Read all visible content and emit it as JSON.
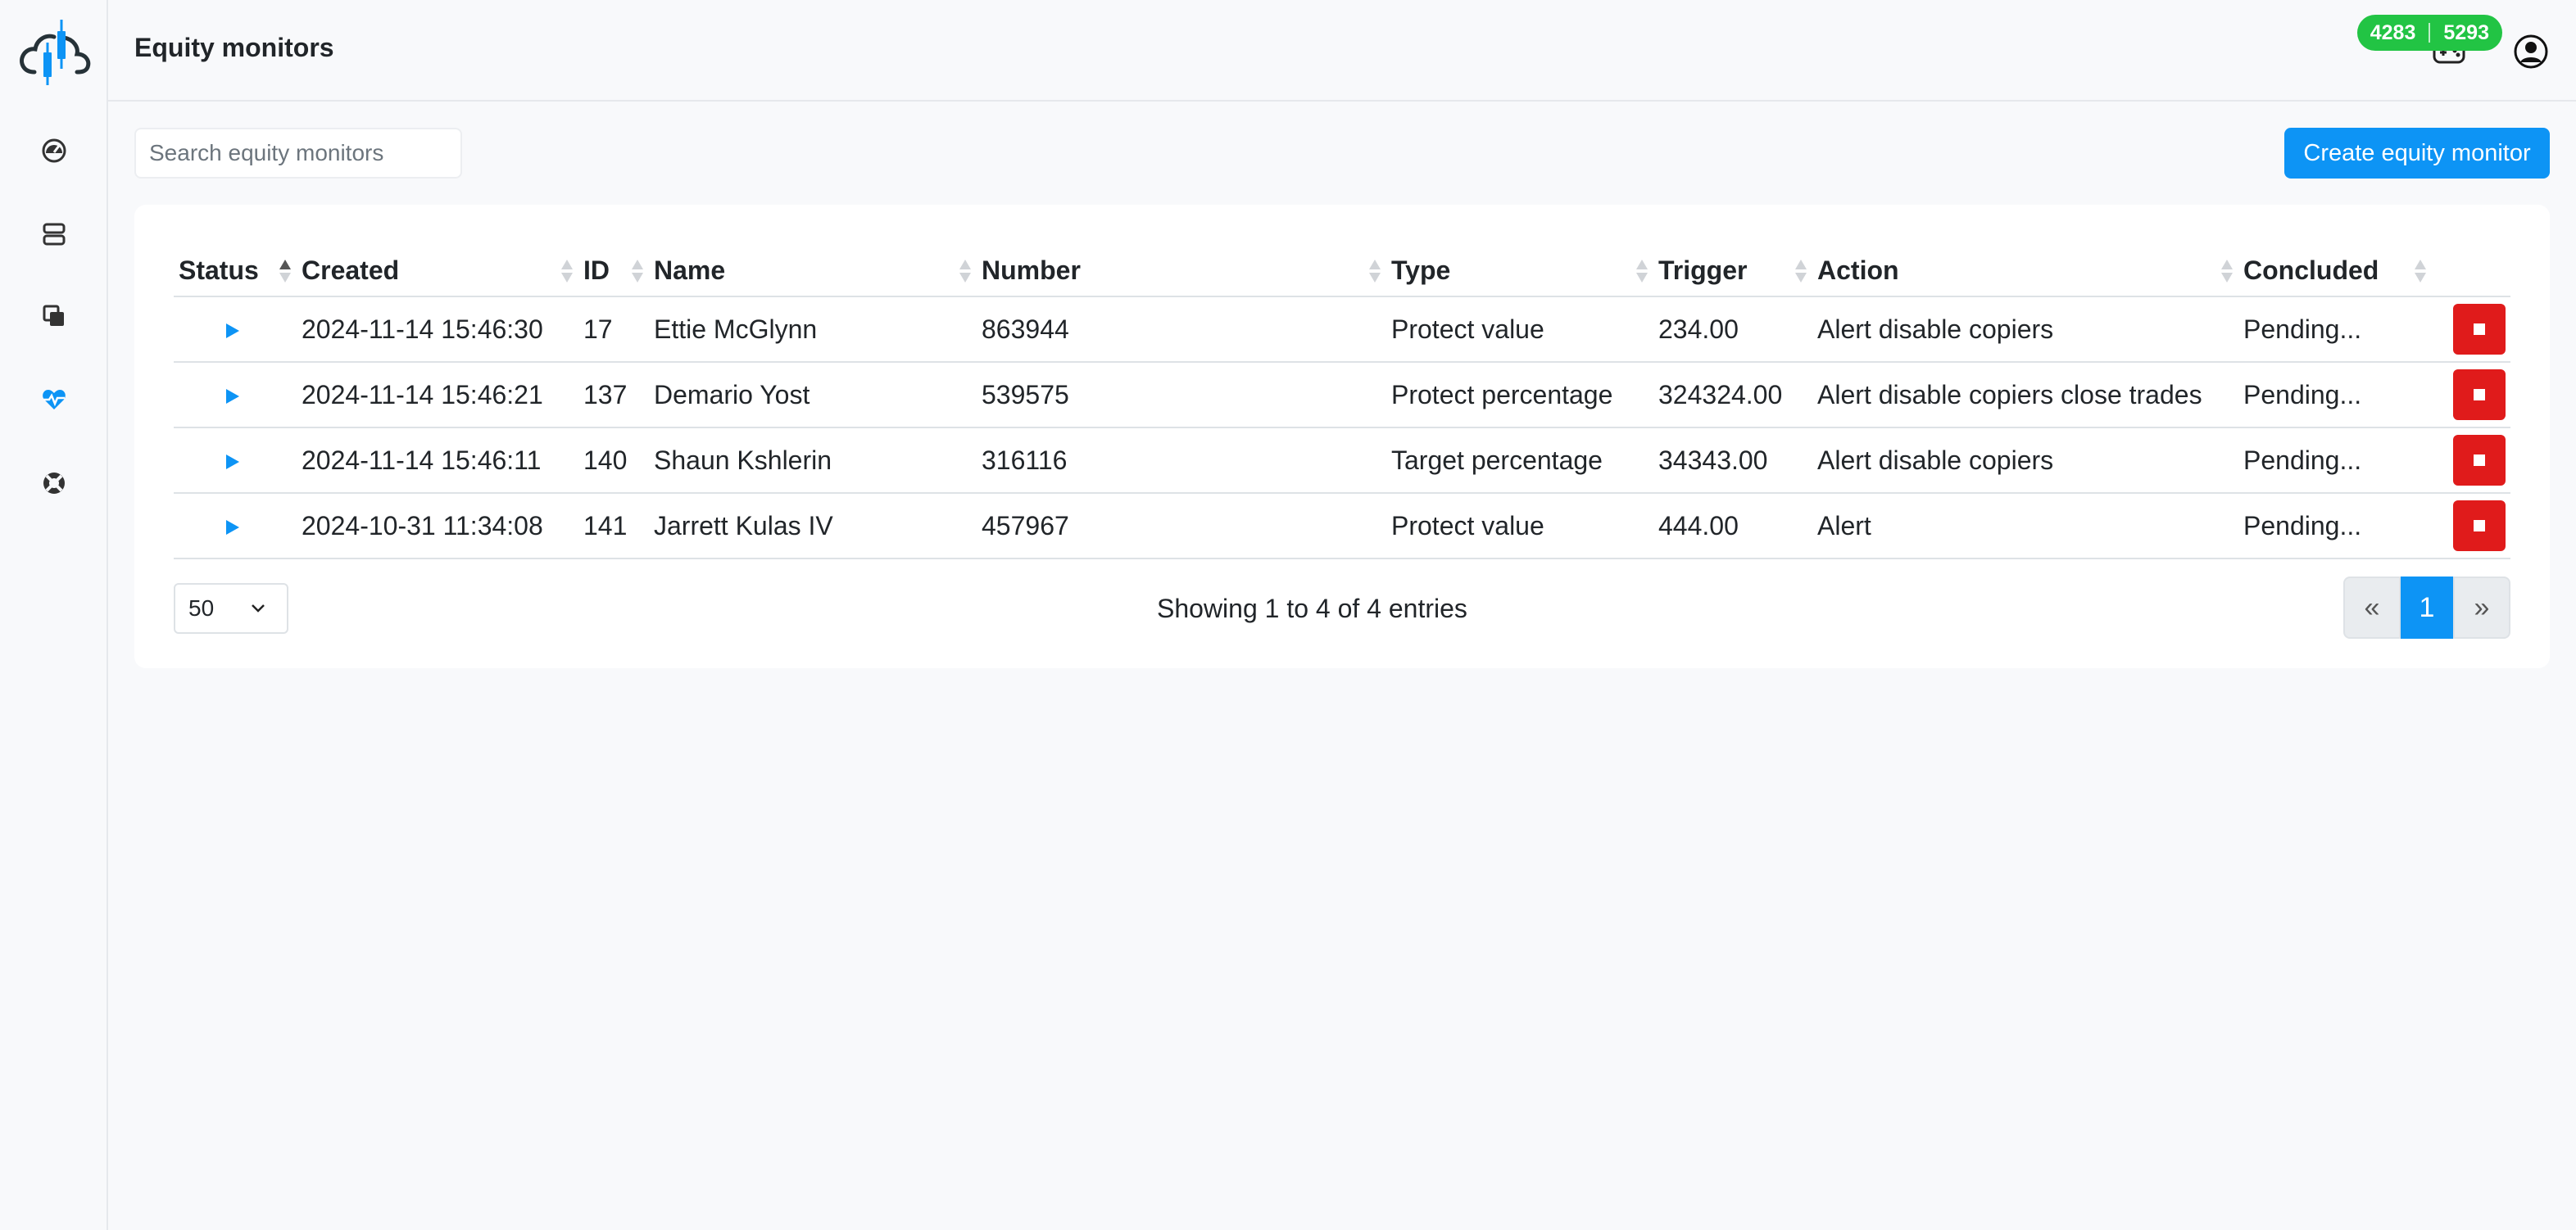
{
  "app": {
    "logo_icon": "cloud-candlestick-logo-icon",
    "accent_color": "#0d94f5"
  },
  "sidebar": {
    "items": [
      {
        "icon": "dashboard-gauge-icon",
        "active": false
      },
      {
        "icon": "server-icon",
        "active": false
      },
      {
        "icon": "copy-icon",
        "active": false
      },
      {
        "icon": "heart-pulse-icon",
        "active": true
      },
      {
        "icon": "lifebuoy-icon",
        "active": false
      }
    ]
  },
  "header": {
    "title": "Equity monitors",
    "counter_left": "4283",
    "counter_right": "5293",
    "counter_color": "#22c444",
    "icons": [
      "gamepad-icon",
      "user-circle-icon"
    ]
  },
  "toolbar": {
    "search_placeholder": "Search equity monitors",
    "create_label": "Create equity monitor"
  },
  "table": {
    "columns": [
      "Status",
      "Created",
      "ID",
      "Name",
      "Number",
      "Type",
      "Trigger",
      "Action",
      "Concluded",
      ""
    ],
    "rows": [
      {
        "status": "running",
        "created": "2024-11-14 15:46:30",
        "id": "17",
        "name": "Ettie McGlynn",
        "number": "863944",
        "type": "Protect value",
        "trigger": "234.00",
        "action": "Alert disable copiers",
        "concluded": "Pending..."
      },
      {
        "status": "running",
        "created": "2024-11-14 15:46:21",
        "id": "137",
        "name": "Demario Yost",
        "number": "539575",
        "type": "Protect percentage",
        "trigger": "324324.00",
        "action": "Alert disable copiers close trades",
        "concluded": "Pending..."
      },
      {
        "status": "running",
        "created": "2024-11-14 15:46:11",
        "id": "140",
        "name": "Shaun Kshlerin",
        "number": "316116",
        "type": "Target percentage",
        "trigger": "34343.00",
        "action": "Alert disable copiers",
        "concluded": "Pending..."
      },
      {
        "status": "running",
        "created": "2024-10-31 11:34:08",
        "id": "141",
        "name": "Jarrett Kulas IV",
        "number": "457967",
        "type": "Protect value",
        "trigger": "444.00",
        "action": "Alert",
        "concluded": "Pending..."
      }
    ],
    "stop_button_color": "#e01b1b"
  },
  "footer": {
    "page_size": "50",
    "entries_info": "Showing 1 to 4 of 4 entries",
    "pagination": {
      "prev": "«",
      "current": "1",
      "next": "»"
    }
  }
}
